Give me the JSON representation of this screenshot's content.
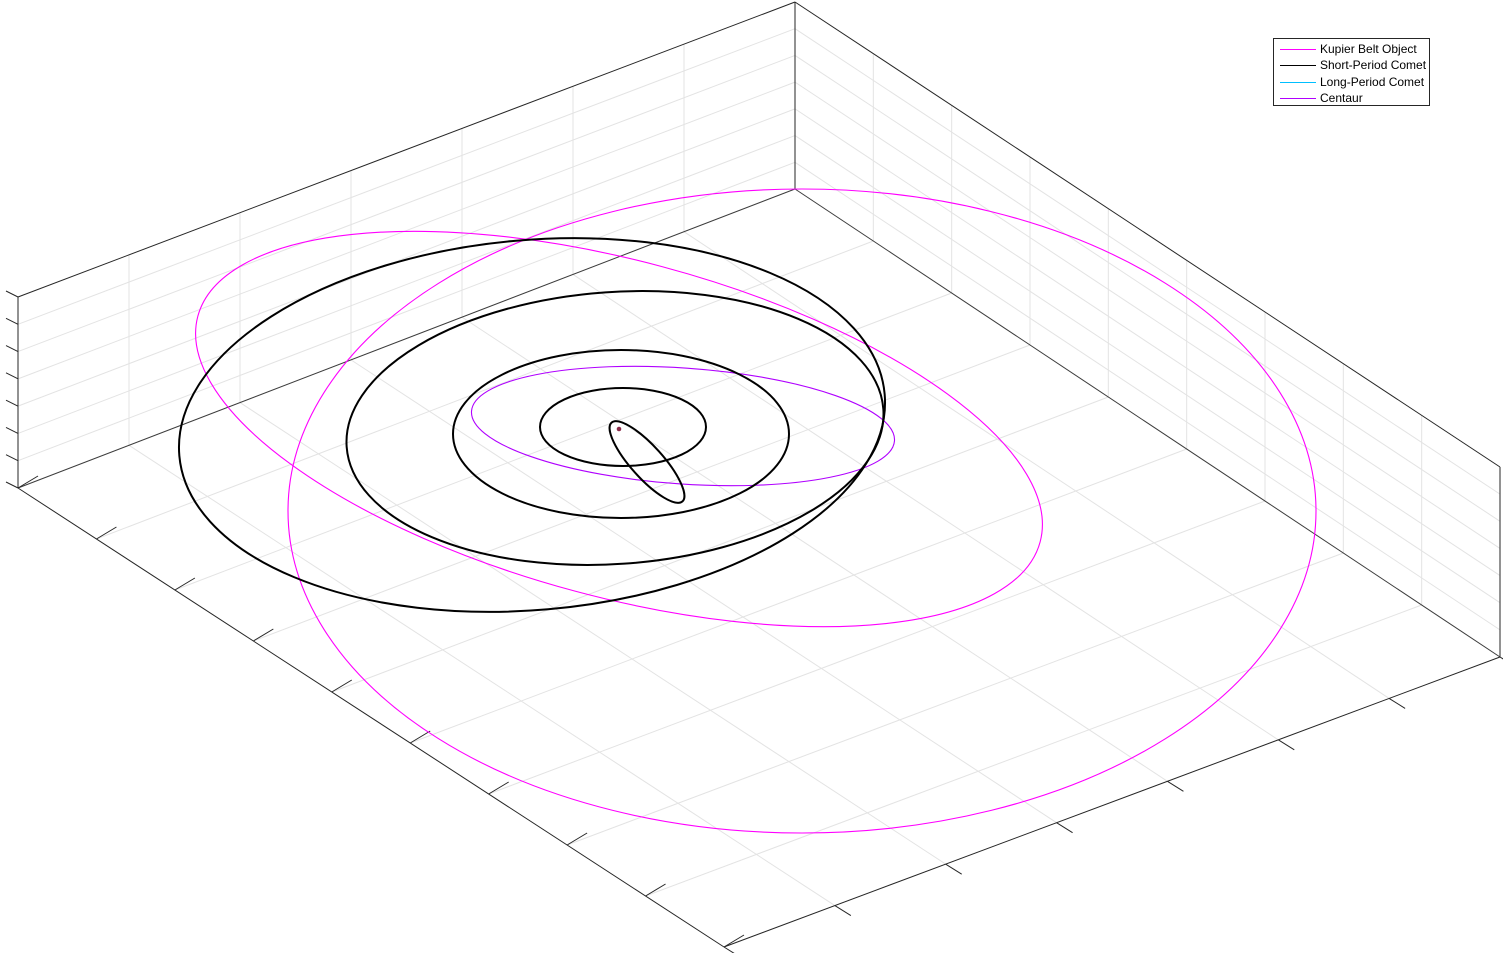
{
  "chart_data": {
    "type": "line",
    "title": "",
    "xlabel": "",
    "ylabel": "",
    "zlabel": "",
    "grid": true,
    "legend_position": "top-right",
    "sun_marker_color": "#8b2b4a",
    "series": [
      {
        "name": "Kupier Belt Object",
        "color": "#ff00ff"
      },
      {
        "name": "Short-Period Comet",
        "color": "#000000"
      },
      {
        "name": "Long-Period Comet",
        "color": "#00bfff"
      },
      {
        "name": "Centaur",
        "color": "#b000ff"
      }
    ]
  }
}
